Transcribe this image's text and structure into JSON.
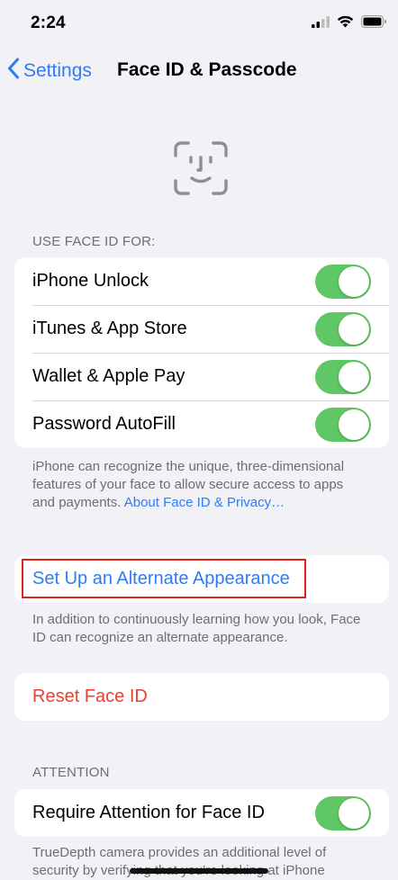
{
  "status": {
    "time": "2:24",
    "icons": [
      "cellular-signal-icon",
      "wifi-icon",
      "battery-icon"
    ]
  },
  "nav": {
    "back_label": "Settings",
    "title": "Face ID & Passcode"
  },
  "use_face_id": {
    "header": "USE FACE ID FOR:",
    "items": [
      {
        "label": "iPhone Unlock",
        "enabled": true
      },
      {
        "label": "iTunes & App Store",
        "enabled": true
      },
      {
        "label": "Wallet & Apple Pay",
        "enabled": true
      },
      {
        "label": "Password AutoFill",
        "enabled": true
      }
    ],
    "footnote_text": "iPhone can recognize the unique, three-dimensional features of your face to allow secure access to apps and payments. ",
    "footnote_link": "About Face ID & Privacy…"
  },
  "alternate": {
    "label": "Set Up an Alternate Appearance",
    "footnote": "In addition to continuously learning how you look, Face ID can recognize an alternate appearance."
  },
  "reset": {
    "label": "Reset Face ID"
  },
  "attention": {
    "header": "ATTENTION",
    "item_label": "Require Attention for Face ID",
    "enabled": true,
    "footnote": "TrueDepth camera provides an additional level of security by verifying that you're looking at iPhone"
  },
  "colors": {
    "accent_blue": "#2F7BF5",
    "toggle_green": "#5FC766",
    "destructive_red": "#EE3D33",
    "background": "#F2F1F6",
    "highlight_red": "#E2211C"
  }
}
